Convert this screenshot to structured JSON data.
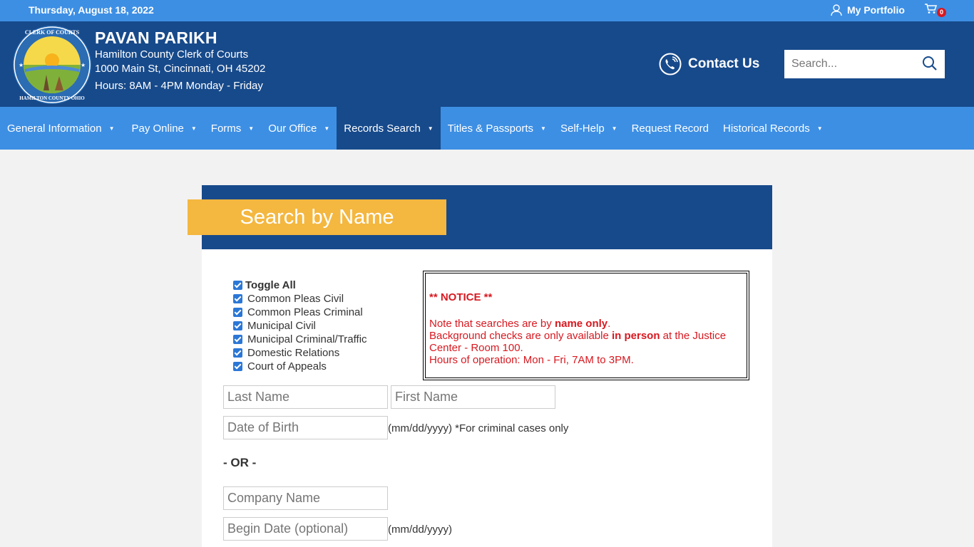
{
  "topbar": {
    "date": "Thursday, August 18, 2022",
    "portfolio_label": "My Portfolio",
    "cart_count": "0"
  },
  "header": {
    "name": "PAVAN PARIKH",
    "line1": "Hamilton County Clerk of Courts",
    "line2": "1000 Main St, Cincinnati, OH 45202",
    "hours": "Hours: 8AM - 4PM Monday - Friday",
    "seal_text_top": "CLERK OF COURTS",
    "seal_text_bottom": "HAMILTON COUNTY OHIO",
    "contact_label": "Contact Us",
    "search_placeholder": "Search..."
  },
  "nav": {
    "items": [
      {
        "label": "General Information"
      },
      {
        "label": "Pay Online"
      },
      {
        "label": "Forms"
      },
      {
        "label": "Our Office"
      },
      {
        "label": "Records Search"
      },
      {
        "label": "Titles & Passports"
      },
      {
        "label": "Self-Help"
      },
      {
        "label": "Request Record"
      },
      {
        "label": "Historical Records"
      }
    ]
  },
  "search": {
    "title": "Search by Name",
    "toggle_all": "Toggle All",
    "courts": [
      "Common Pleas Civil",
      "Common Pleas Criminal",
      "Municipal Civil",
      "Municipal Criminal/Traffic",
      "Domestic Relations",
      "Court of Appeals"
    ],
    "notice": {
      "heading": "** NOTICE **",
      "l1a": "Note that searches are by ",
      "l1b": "name only",
      "l1c": ".",
      "l2a": "Background checks are only available ",
      "l2b": "in person",
      "l2c": " at the Justice Center - Room 100.",
      "l3": "Hours of operation: Mon - Fri, 7AM to 3PM."
    },
    "last_name_placeholder": "Last Name",
    "first_name_placeholder": "First Name",
    "dob_placeholder": "Date of Birth",
    "dob_hint": "(mm/dd/yyyy) *For criminal cases only",
    "or_label": "- OR -",
    "company_placeholder": "Company Name",
    "begin_date_placeholder": "Begin Date (optional)",
    "begin_date_hint": "(mm/dd/yyyy)"
  },
  "colors": {
    "top_blue": "#3d8fe4",
    "dark_blue": "#174a8b",
    "gold": "#f4b73f",
    "notice_red": "#d71920"
  }
}
